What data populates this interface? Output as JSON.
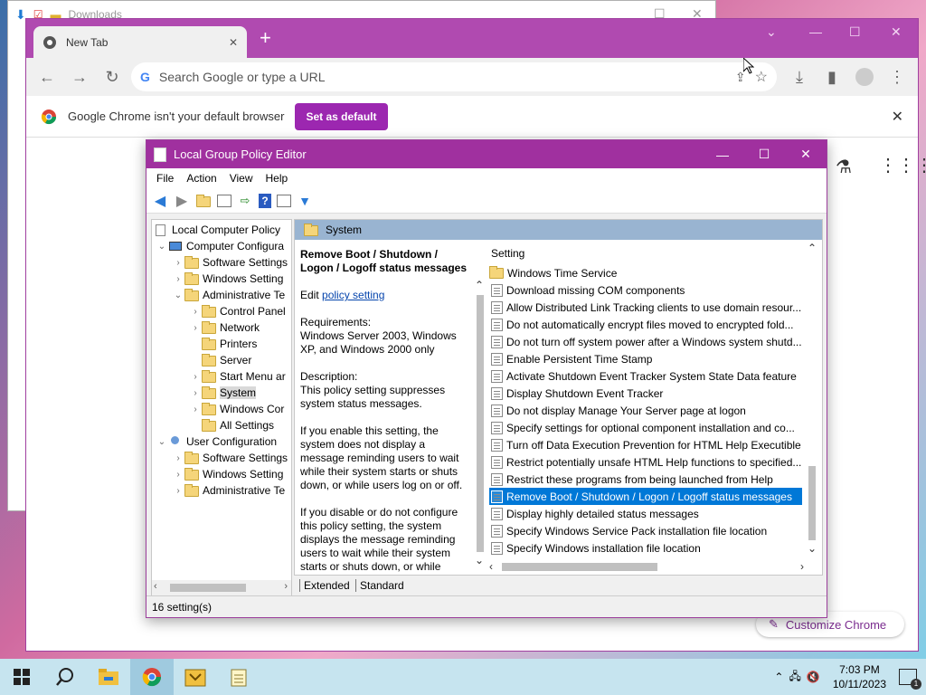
{
  "explorer": {
    "title": "Downloads"
  },
  "chrome": {
    "tab_title": "New Tab",
    "omnibox_placeholder": "Search Google or type a URL",
    "infobar_text": "Google Chrome isn't your default browser",
    "set_default_label": "Set as default",
    "customize_label": "Customize Chrome",
    "accent_color": "#b04ab0"
  },
  "gpe": {
    "title": "Local Group Policy Editor",
    "menu": [
      "File",
      "Action",
      "View",
      "Help"
    ],
    "tree": [
      {
        "label": "Local Computer Policy"
      },
      {
        "label": "Computer Configura"
      },
      {
        "label": "Software Settings"
      },
      {
        "label": "Windows Setting"
      },
      {
        "label": "Administrative Te"
      },
      {
        "label": "Control Panel"
      },
      {
        "label": "Network"
      },
      {
        "label": "Printers"
      },
      {
        "label": "Server"
      },
      {
        "label": "Start Menu ar"
      },
      {
        "label": "System"
      },
      {
        "label": "Windows Cor"
      },
      {
        "label": "All Settings"
      },
      {
        "label": "User Configuration"
      },
      {
        "label": "Software Settings"
      },
      {
        "label": "Windows Setting"
      },
      {
        "label": "Administrative Te"
      }
    ],
    "pane_header": "System",
    "description": {
      "title": "Remove Boot / Shutdown / Logon / Logoff status messages",
      "edit_prefix": "Edit",
      "edit_link": "policy setting",
      "requirements_label": "Requirements:",
      "requirements": "Windows Server 2003, Windows XP, and Windows 2000 only",
      "description_label": "Description:",
      "description": "This policy setting suppresses system status messages.",
      "enable_text": "If you enable this setting, the system does not display a message reminding users to wait while their system starts or shuts down, or while users log on or off.",
      "disable_text": "If you disable or do not configure this policy setting, the system displays the message reminding users to wait while their system starts or shuts down, or while"
    },
    "list_header": "Setting",
    "settings": [
      {
        "label": "Windows Time Service",
        "kind": "folder"
      },
      {
        "label": "Download missing COM components",
        "kind": "policy"
      },
      {
        "label": "Allow Distributed Link Tracking clients to use domain resour...",
        "kind": "policy"
      },
      {
        "label": "Do not automatically encrypt files moved to encrypted fold...",
        "kind": "policy"
      },
      {
        "label": "Do not turn off system power after a Windows system shutd...",
        "kind": "policy"
      },
      {
        "label": "Enable Persistent Time Stamp",
        "kind": "policy"
      },
      {
        "label": "Activate Shutdown Event Tracker System State Data feature",
        "kind": "policy"
      },
      {
        "label": "Display Shutdown Event Tracker",
        "kind": "policy"
      },
      {
        "label": "Do not display Manage Your Server page at logon",
        "kind": "policy"
      },
      {
        "label": "Specify settings for optional component installation and co...",
        "kind": "policy"
      },
      {
        "label": "Turn off Data Execution Prevention for HTML Help Executible",
        "kind": "policy"
      },
      {
        "label": "Restrict potentially unsafe HTML Help functions to specified...",
        "kind": "policy"
      },
      {
        "label": "Restrict these programs from being launched from Help",
        "kind": "policy"
      },
      {
        "label": "Remove Boot / Shutdown / Logon / Logoff status messages",
        "kind": "policy",
        "selected": true
      },
      {
        "label": "Display highly detailed status messages",
        "kind": "policy"
      },
      {
        "label": "Specify Windows Service Pack installation file location",
        "kind": "policy"
      },
      {
        "label": "Specify Windows installation file location",
        "kind": "policy"
      }
    ],
    "tab_extended": "Extended",
    "tab_standard": "Standard",
    "status": "16 setting(s)"
  },
  "taskbar": {
    "time": "7:03 PM",
    "date": "10/11/2023",
    "notification_count": "1"
  }
}
